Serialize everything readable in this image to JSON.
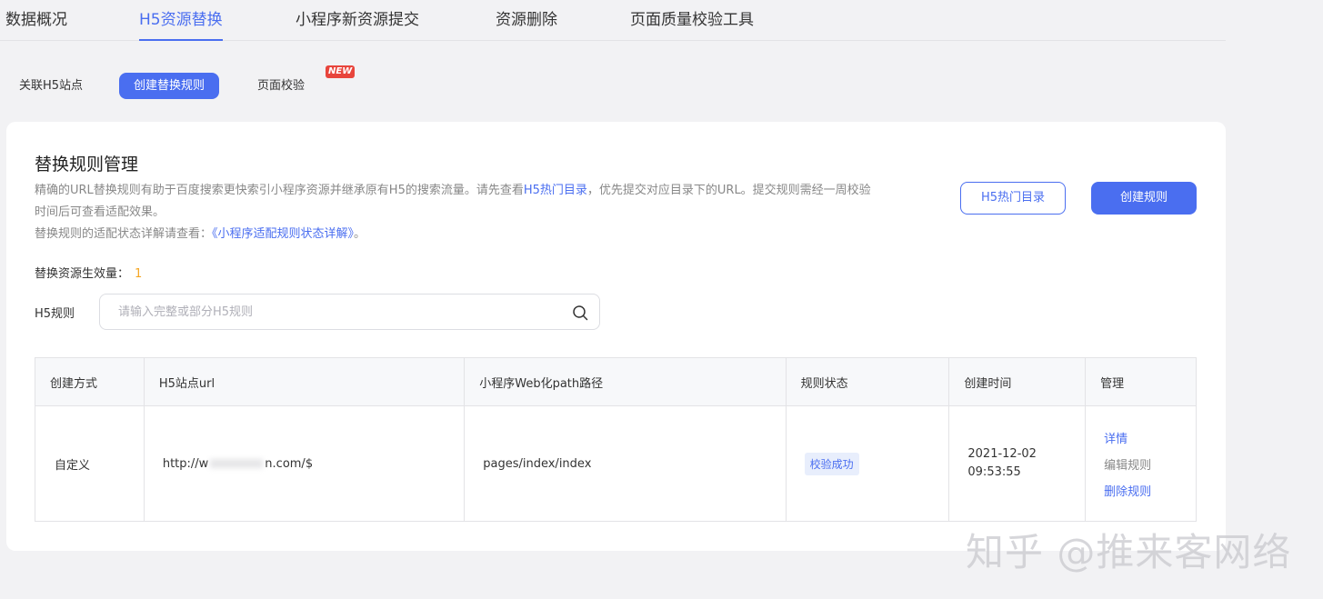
{
  "top_tabs": [
    "数据概况",
    "H5资源替换",
    "小程序新资源提交",
    "资源删除",
    "页面质量校验工具"
  ],
  "sub_tabs": [
    "关联H5站点",
    "创建替换规则",
    "页面校验"
  ],
  "badge_new": "NEW",
  "card": {
    "title": "替换规则管理",
    "desc_line1_a": "精确的URL替换规则有助于百度搜索更快索引小程序资源并继承原有H5的搜索流量。请先查看",
    "desc_line1_link": "H5热门目录",
    "desc_line1_b": "，优先提交对应目录下的URL。提交规则需经一周校验",
    "desc_line2": "时间后可查看适配效果。",
    "desc_line3_a": "替换规则的适配状态详解请查看：",
    "desc_line3_link": "《小程序适配规则状态详解》",
    "desc_line3_b": "。",
    "btn_hot_dir": "H5热门目录",
    "btn_create": "创建规则",
    "count_label": "替换资源生效量：",
    "count_value": "1",
    "filter_label": "H5规则",
    "search_placeholder": "请输入完整或部分H5规则"
  },
  "table": {
    "headers": [
      "创建方式",
      "H5站点url",
      "小程序Web化path路径",
      "规则状态",
      "创建时间",
      "管理"
    ],
    "rows": [
      {
        "method": "自定义",
        "url_prefix": "http://w",
        "url_suffix": "n.com/$",
        "path": "pages/index/index",
        "status": "校验成功",
        "date": "2021-12-02",
        "time": "09:53:55",
        "action_detail": "详情",
        "action_edit": "编辑规则",
        "action_delete": "删除规则"
      }
    ]
  },
  "watermark": "知乎 @推来客网络",
  "colors": {
    "accent": "#4a6ef0",
    "count": "#f5a623",
    "new_badge": "#e8453c"
  }
}
